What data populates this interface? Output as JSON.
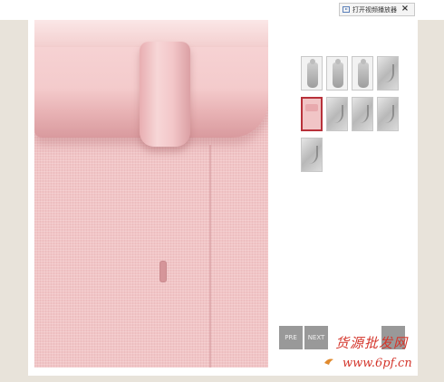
{
  "toolbar": {
    "player_label": "打开视频播放器",
    "close_glyph": "×"
  },
  "thumbnails": [
    {
      "icon": "coat-front"
    },
    {
      "icon": "coat-side"
    },
    {
      "icon": "coat-back"
    },
    {
      "icon": "collar-detail"
    },
    {
      "icon": "fabric-detail",
      "selected": true
    },
    {
      "icon": "sleeve-detail"
    },
    {
      "icon": "button-detail"
    },
    {
      "icon": "pocket-detail"
    },
    {
      "icon": "lining-detail"
    }
  ],
  "nav": {
    "prev_label": "PRE",
    "next_label": "NEXT"
  },
  "watermark": {
    "text": "货源批发网",
    "url": "www.6pf.cn"
  },
  "colors": {
    "fabric": "#f1c5c6",
    "selected_border": "#b8313a",
    "watermark": "#d4352b"
  }
}
